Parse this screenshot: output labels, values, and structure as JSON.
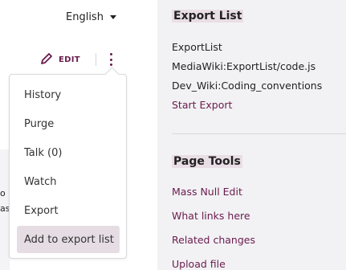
{
  "header": {
    "language": "English",
    "edit_label": "EDIT"
  },
  "left_fragments": [
    "o",
    "as"
  ],
  "menu": {
    "items": [
      {
        "label": "History"
      },
      {
        "label": "Purge"
      },
      {
        "label": "Talk (0)"
      },
      {
        "label": "Watch"
      },
      {
        "label": "Export"
      },
      {
        "label": "Add to export list"
      }
    ],
    "selected": "Add to export list"
  },
  "export_list": {
    "title": "Export List",
    "items": [
      "ExportList",
      "MediaWiki:ExportList/code.js",
      "Dev_Wiki:Coding_conventions"
    ],
    "start_export": "Start Export"
  },
  "page_tools": {
    "title": "Page Tools",
    "links": [
      "Mass Null Edit",
      "What links here",
      "Related changes",
      "Upload file"
    ]
  },
  "colors": {
    "accent": "#6a1b4d",
    "highlight": "#e9dde6",
    "panel_bg": "#f2f2f4"
  }
}
